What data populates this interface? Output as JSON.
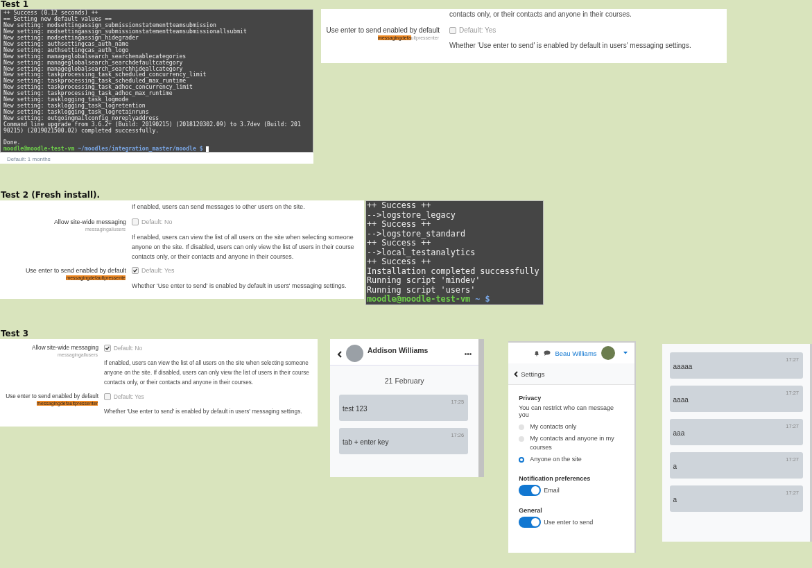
{
  "sections": [
    {
      "title": "Test 1",
      "panels": [
        {
          "kind": "terminal",
          "lines": [
            {
              "kind": "output",
              "text": "++ Success (0.12 seconds) ++"
            },
            {
              "kind": "output",
              "text": "== Setting new default values =="
            },
            {
              "kind": "output",
              "text": "New setting: modsettingassign_submissionstatementteamsubmission"
            },
            {
              "kind": "output",
              "text": "New setting: modsettingassign_submissionstatementteamsubmissionallsubmit"
            },
            {
              "kind": "output",
              "text": "New setting: modsettingassign_hidegrader"
            },
            {
              "kind": "output",
              "text": "New setting: authsettingcas_auth_name"
            },
            {
              "kind": "output",
              "text": "New setting: authsettingcas_auth_logo"
            },
            {
              "kind": "output",
              "text": "New setting: manageglobalsearch_searchenablecategories"
            },
            {
              "kind": "output",
              "text": "New setting: manageglobalsearch_searchdefaultcategory"
            },
            {
              "kind": "output",
              "text": "New setting: manageglobalsearch_searchhideallcategory"
            },
            {
              "kind": "output",
              "text": "New setting: taskprocessing_task_scheduled_concurrency_limit"
            },
            {
              "kind": "output",
              "text": "New setting: taskprocessing_task_scheduled_max_runtime"
            },
            {
              "kind": "output",
              "text": "New setting: taskprocessing_task_adhoc_concurrency_limit"
            },
            {
              "kind": "output",
              "text": "New setting: taskprocessing_task_adhoc_max_runtime"
            },
            {
              "kind": "output",
              "text": "New setting: tasklogging_task_logmode"
            },
            {
              "kind": "output",
              "text": "New setting: tasklogging_task_logretention"
            },
            {
              "kind": "output",
              "text": "New setting: tasklogging_task_logretainruns"
            },
            {
              "kind": "output",
              "text": "New setting: outgoingmailconfig_noreplyaddress"
            },
            {
              "kind": "output",
              "text": "Command line upgrade from 3.6.2+ (Build: 20190215) (2018120302.09) to 3.7dev (Build: 201"
            },
            {
              "kind": "output",
              "text": "90215) (2019021500.02) completed successfully."
            },
            {
              "kind": "blank"
            },
            {
              "kind": "output",
              "text": "Done."
            },
            {
              "kind": "prompt",
              "user": "moodle@moodle-test-vm",
              "path": "~/moodles/integration_master/moodle",
              "symbol": "$"
            }
          ],
          "footer": "Default: 1 months"
        },
        {
          "kind": "admin_settings",
          "lead": [
            "contacts only, or their contacts and anyone in their courses."
          ],
          "settings": [
            {
              "label": "Use enter to send enabled by default",
              "key_highlight": "messagingdefa",
              "key_rest": "ultpressenter",
              "checked": false,
              "default": "Default: Yes",
              "description": [
                "Whether 'Use enter to send' is enabled by default in users' messaging settings."
              ]
            }
          ]
        }
      ]
    },
    {
      "title": "Test 2 (Fresh install).",
      "panels": [
        {
          "kind": "admin_settings",
          "lead": [
            "If enabled, users can send messages to other users on the site."
          ],
          "settings": [
            {
              "label": "Allow site-wide messaging",
              "key_rest": "messagingallusers",
              "checked": false,
              "default": "Default: No",
              "description": [
                "If enabled, users can view the list of all users on the site when selecting someone",
                "anyone on the site. If disabled, users can only view the list of users in their course",
                "contacts only, or their contacts and anyone in their courses."
              ]
            },
            {
              "label": "Use enter to send enabled by default",
              "key_highlight": "messagingdefaultpressente",
              "checked": true,
              "default": "Default: Yes",
              "description": [
                "Whether 'Use enter to send' is enabled by default in users' messaging settings."
              ]
            }
          ]
        },
        {
          "kind": "terminal",
          "lines": [
            {
              "kind": "output",
              "text": "++ Success ++"
            },
            {
              "kind": "output",
              "text": "-->logstore_legacy"
            },
            {
              "kind": "output",
              "text": "++ Success ++"
            },
            {
              "kind": "output",
              "text": "-->logstore_standard"
            },
            {
              "kind": "output",
              "text": "++ Success ++"
            },
            {
              "kind": "output",
              "text": "-->local_testanalytics"
            },
            {
              "kind": "output",
              "text": "++ Success ++"
            },
            {
              "kind": "output",
              "text": "Installation completed successfully"
            },
            {
              "kind": "output",
              "text": "Running script 'mindev'"
            },
            {
              "kind": "output",
              "text": "Running script 'users'"
            },
            {
              "kind": "prompt",
              "user": "moodle@moodle-test-vm",
              "path": "~",
              "symbol": "$"
            }
          ]
        }
      ]
    },
    {
      "title": "Test 3",
      "panels": [
        {
          "kind": "admin_settings",
          "settings": [
            {
              "label": "Allow site-wide messaging",
              "key_rest": "messagingallusers",
              "checked": true,
              "default": "Default: No",
              "description": [
                "If enabled, users can view the list of all users on the site when selecting someone",
                "anyone on the site. If disabled, users can only view the list of users in their course",
                "contacts only, or their contacts and anyone in their courses."
              ]
            },
            {
              "label": "Use enter to send enabled by default",
              "key_highlight": "messagingdefaultpressenter",
              "checked": false,
              "default": "Default: Yes",
              "description": [
                "Whether 'Use enter to send' is enabled by default in users' messaging settings."
              ]
            }
          ]
        },
        {
          "kind": "chat",
          "name": "Addison Williams",
          "date": "21 February",
          "messages": [
            {
              "time": "17:25",
              "text": "test 123"
            },
            {
              "time": "17:26",
              "text": "tab + enter key"
            }
          ]
        },
        {
          "kind": "messaging_settings",
          "user": "Beau Williams",
          "back": "Settings",
          "groups": [
            {
              "kind": "radios",
              "title": "Privacy",
              "hint": "You can restrict who can message you",
              "options": [
                {
                  "label": "My contacts only",
                  "selected": false
                },
                {
                  "label": "My contacts and anyone in my courses",
                  "selected": false
                },
                {
                  "label": "Anyone on the site",
                  "selected": true
                }
              ]
            },
            {
              "kind": "toggles",
              "title": "Notification preferences",
              "options": [
                {
                  "label": "Email",
                  "on": true
                }
              ]
            },
            {
              "kind": "toggles",
              "title": "General",
              "options": [
                {
                  "label": "Use enter to send",
                  "on": true
                }
              ]
            }
          ]
        },
        {
          "kind": "message_list",
          "messages": [
            {
              "time": "17:27",
              "text": "aaaaa"
            },
            {
              "time": "17:27",
              "text": "aaaa"
            },
            {
              "time": "17:27",
              "text": "aaa"
            },
            {
              "time": "17:27",
              "text": "a"
            },
            {
              "time": "17:27",
              "text": "a"
            }
          ]
        }
      ]
    }
  ]
}
